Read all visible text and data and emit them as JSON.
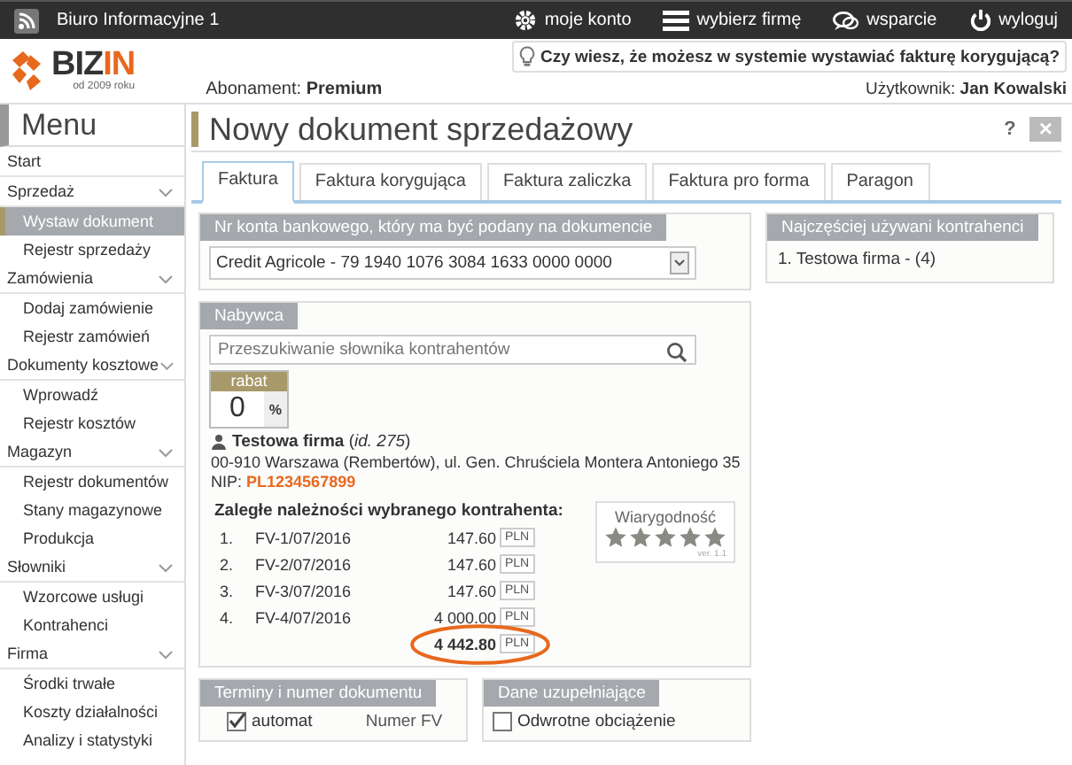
{
  "topbar": {
    "title": "Biuro Informacyjne 1",
    "links": [
      {
        "kind": "gear",
        "label": "moje konto"
      },
      {
        "kind": "list",
        "label": "wybierz firmę"
      },
      {
        "kind": "chat",
        "label": "wsparcie"
      },
      {
        "kind": "power",
        "label": "wyloguj"
      }
    ]
  },
  "header": {
    "logo": {
      "text_a": "BIZ",
      "text_b": "IN",
      "tagline": "od 2009 roku"
    },
    "subscription": "Abonament: **Premium**",
    "tip": "Czy wiesz, że możesz w systemie wystawiać fakturę korygującą?",
    "user": "Użytkownik: **Jan Kowalski**"
  },
  "sidebar": {
    "title": "Menu",
    "sections": [
      {
        "label": "Start"
      },
      {
        "label": "Sprzedaż",
        "expanded": true,
        "children": [
          {
            "label": "Wystaw dokument",
            "selected": true
          },
          {
            "label": "Rejestr sprzedaży",
            "selected": false
          }
        ]
      },
      {
        "label": "Zamówienia",
        "expanded": true,
        "children": [
          {
            "label": "Dodaj zamówienie",
            "selected": false
          },
          {
            "label": "Rejestr zamówień",
            "selected": false
          }
        ]
      },
      {
        "label": "Dokumenty kosztowe",
        "expanded": true,
        "children": [
          {
            "label": "Wprowadź",
            "selected": false
          },
          {
            "label": "Rejestr kosztów",
            "selected": false
          }
        ]
      },
      {
        "label": "Magazyn",
        "expanded": true,
        "children": [
          {
            "label": "Rejestr dokumentów",
            "selected": false
          },
          {
            "label": "Stany magazynowe",
            "selected": false
          },
          {
            "label": "Produkcja",
            "selected": false
          }
        ]
      },
      {
        "label": "Słowniki",
        "expanded": true,
        "children": [
          {
            "label": "Wzorcowe usługi",
            "selected": false
          },
          {
            "label": "Kontrahenci",
            "selected": false
          }
        ]
      },
      {
        "label": "Firma",
        "expanded": true,
        "children": [
          {
            "label": "Środki trwałe",
            "selected": false
          },
          {
            "label": "Koszty działalności",
            "selected": false
          },
          {
            "label": "Analizy i statystyki",
            "selected": false
          }
        ]
      }
    ]
  },
  "page": {
    "title": "Nowy dokument sprzedażowy",
    "help": "?",
    "close": "×",
    "tabs": [
      {
        "label": "Faktura",
        "selected": true
      },
      {
        "label": "Faktura korygująca",
        "selected": false
      },
      {
        "label": "Faktura zaliczka",
        "selected": false
      },
      {
        "label": "Faktura pro forma",
        "selected": false
      },
      {
        "label": "Paragon",
        "selected": false
      }
    ],
    "bank": {
      "title": "Nr konta bankowego, który ma być podany na dokumencie",
      "value": "Credit Agricole - 79 1940 1076 3084 1633 0000 0000"
    },
    "buyer": {
      "title": "Nabywca",
      "search_placeholder": "Przeszukiwanie słownika kontrahentów",
      "discount_label": "rabat",
      "discount_value": "0",
      "discount_unit": "%",
      "name": "**Testowa firma** (*id. 275*)",
      "address": "00-910 Warszawa (Rembertów), ul. Gen. Chruściela Montera Antoniego 35",
      "nip_label": "NIP:",
      "nip": "PL1234567899",
      "debts_title": "Zaległe należności wybranego kontrahenta:",
      "debts": [
        {
          "no": "1.",
          "doc": "FV-1/07/2016",
          "amount": "147.60",
          "currency": "PLN"
        },
        {
          "no": "2.",
          "doc": "FV-2/07/2016",
          "amount": "147.60",
          "currency": "PLN"
        },
        {
          "no": "3.",
          "doc": "FV-3/07/2016",
          "amount": "147.60",
          "currency": "PLN"
        },
        {
          "no": "4.",
          "doc": "FV-4/07/2016",
          "amount": "4 000.00",
          "currency": "PLN"
        }
      ],
      "total": "4 442.80",
      "total_currency": "PLN",
      "reliability": {
        "title": "Wiarygodność",
        "stars": 5,
        "version": "ver. 1.1"
      }
    },
    "frequent": {
      "title": "Najczęściej używani kontrahenci",
      "items": [
        "1. Testowa firma - (4)"
      ]
    },
    "terms": {
      "title": "Terminy i numer dokumentu",
      "auto_label": "automat",
      "auto_checked": true,
      "number_label": "Numer FV"
    },
    "extra": {
      "title": "Dane uzupełniające",
      "reverse_label": "Odwrotne obciążenie",
      "reverse_checked": false
    }
  }
}
